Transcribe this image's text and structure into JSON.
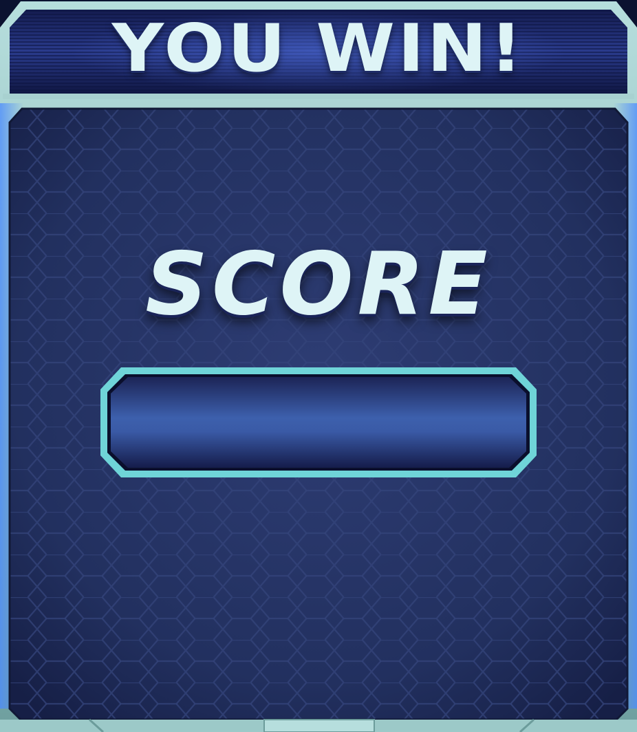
{
  "banner": {
    "title": "YOU WIN!"
  },
  "score_panel": {
    "label": "SCORE",
    "value": ""
  },
  "colors": {
    "frame_teal": "#8fbfbe",
    "banner_navy": "#1c2a6e",
    "panel_navy": "#24305f",
    "field_blue": "#3a5aa6",
    "field_border": "#6fd4d8",
    "text_light": "#def4f6"
  }
}
